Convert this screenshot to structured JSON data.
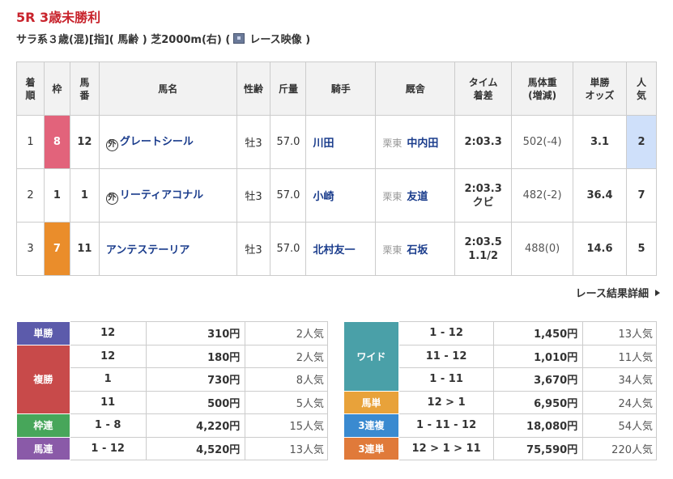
{
  "race": {
    "title": "5R 3歳未勝利",
    "conditions": "サラ系３歳(混)[指]( 馬齢 ) 芝2000m(右)  (",
    "video_label": "レース映像 )"
  },
  "result_table": {
    "headers": {
      "rank": "着\n順",
      "waku": "枠",
      "umaban": "馬\n番",
      "horse": "馬名",
      "sexage": "性齢",
      "kinryo": "斤量",
      "jockey": "騎手",
      "trainer": "厩舎",
      "time": "タイム\n着差",
      "weight": "馬体重\n(増減)",
      "odds": "単勝\nオッズ",
      "pop": "人\n気"
    },
    "rows": [
      {
        "rank": "1",
        "waku": "8",
        "umaban": "12",
        "foreign": "外",
        "horse": "グレートシール",
        "sexage": "牡3",
        "kinryo": "57.0",
        "jockey": "川田",
        "area": "栗東",
        "trainer": "中内田",
        "time": "2:03.3",
        "margin": "",
        "weight": "502(-4)",
        "odds": "3.1",
        "pop": "2"
      },
      {
        "rank": "2",
        "waku": "1",
        "umaban": "1",
        "foreign": "外",
        "horse": "リーティアコナル",
        "sexage": "牡3",
        "kinryo": "57.0",
        "jockey": "小崎",
        "area": "栗東",
        "trainer": "友道",
        "time": "2:03.3",
        "margin": "クビ",
        "weight": "482(-2)",
        "odds": "36.4",
        "pop": "7"
      },
      {
        "rank": "3",
        "waku": "7",
        "umaban": "11",
        "foreign": "",
        "horse": "アンテステーリア",
        "sexage": "牡3",
        "kinryo": "57.0",
        "jockey": "北村友一",
        "area": "栗東",
        "trainer": "石坂",
        "time": "2:03.5",
        "margin": "1.1/2",
        "weight": "488(0)",
        "odds": "14.6",
        "pop": "5"
      }
    ]
  },
  "detail_link": "レース結果詳細",
  "payouts_left": {
    "tansho": {
      "label": "単勝",
      "combo": "12",
      "amount": "310円",
      "pop": "2人気"
    },
    "fukusho": {
      "label": "複勝",
      "rows": [
        {
          "combo": "12",
          "amount": "180円",
          "pop": "2人気"
        },
        {
          "combo": "1",
          "amount": "730円",
          "pop": "8人気"
        },
        {
          "combo": "11",
          "amount": "500円",
          "pop": "5人気"
        }
      ]
    },
    "wakuren": {
      "label": "枠連",
      "combo": "1 - 8",
      "amount": "4,220円",
      "pop": "15人気"
    },
    "umaren": {
      "label": "馬連",
      "combo": "1 - 12",
      "amount": "4,520円",
      "pop": "13人気"
    }
  },
  "payouts_right": {
    "wide": {
      "label": "ワイド",
      "rows": [
        {
          "combo": "1 - 12",
          "amount": "1,450円",
          "pop": "13人気"
        },
        {
          "combo": "11 - 12",
          "amount": "1,010円",
          "pop": "11人気"
        },
        {
          "combo": "1 - 11",
          "amount": "3,670円",
          "pop": "34人気"
        }
      ]
    },
    "umatan": {
      "label": "馬単",
      "combo": "12 > 1",
      "amount": "6,950円",
      "pop": "24人気"
    },
    "sanrenpuku": {
      "label": "3連複",
      "combo": "1 - 11 - 12",
      "amount": "18,080円",
      "pop": "54人気"
    },
    "sanrentan": {
      "label": "3連単",
      "combo": "12 > 1 > 11",
      "amount": "75,590円",
      "pop": "220人気"
    }
  },
  "colors": {
    "title": "#c8232c",
    "waku_8": "#e2637b",
    "waku_7": "#ea8d2b",
    "link_blue": "#1a3c8c",
    "pop1_highlight": "#cfe0fa"
  }
}
